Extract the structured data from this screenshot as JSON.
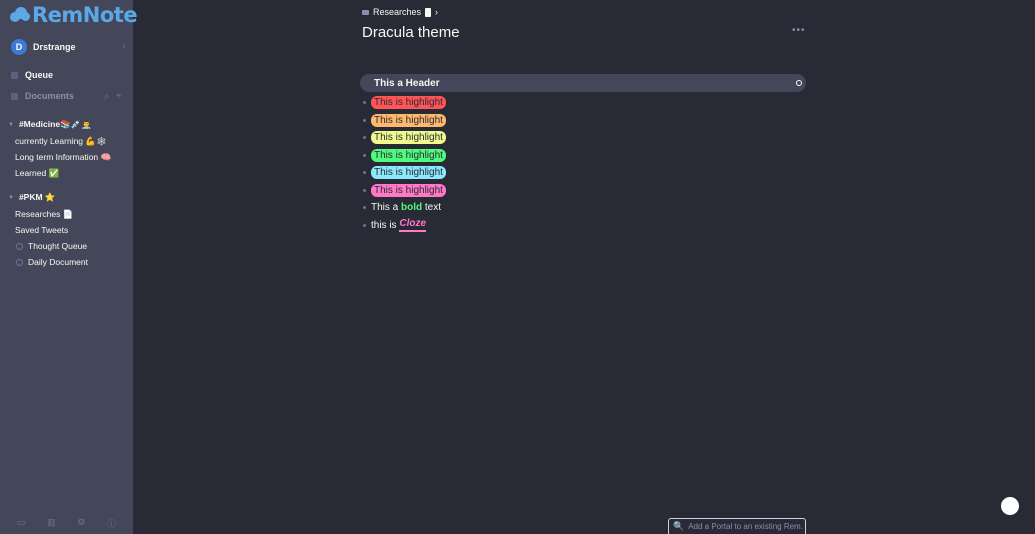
{
  "app": {
    "logo_text": "RemNote",
    "accent": "#5aa9e6"
  },
  "user": {
    "initial": "D",
    "name": "Drstrange"
  },
  "sidebar": {
    "queue_label": "Queue",
    "documents_label": "Documents",
    "sections": [
      {
        "title": "#Medicine📚💉👨‍⚕️",
        "items": [
          "currently Learning 💪🕸",
          "Long term Information 🧠",
          "Learned ✅"
        ]
      },
      {
        "title": "#PKM ⭐",
        "items": [
          "Researches 📄",
          "Saved Tweets"
        ],
        "sub_items": [
          "Thought Queue",
          "Daily Document"
        ]
      }
    ]
  },
  "breadcrumb": {
    "parent": "Researches"
  },
  "document": {
    "title": "Dracula theme",
    "header": "This a Header",
    "highlights": [
      {
        "text": "This is highlight",
        "color": "#ff5555"
      },
      {
        "text": "This is highlight",
        "color": "#ffb86c"
      },
      {
        "text": "This is highlight",
        "color": "#f1fa8c"
      },
      {
        "text": "This is highlight",
        "color": "#50fa7b"
      },
      {
        "text": "This is highlight",
        "color": "#8be9fd"
      },
      {
        "text": "This is highlight",
        "color": "#ff79c6"
      }
    ],
    "bold_line": {
      "before": "This a",
      "bold": "bold",
      "after": "text"
    },
    "cloze_line": {
      "before": "this is",
      "cloze": "Cloze"
    }
  },
  "portal": {
    "placeholder": "Add a Portal to an existing Rem."
  },
  "theme": {
    "background": "#282a36",
    "sidebar": "#44475a"
  }
}
